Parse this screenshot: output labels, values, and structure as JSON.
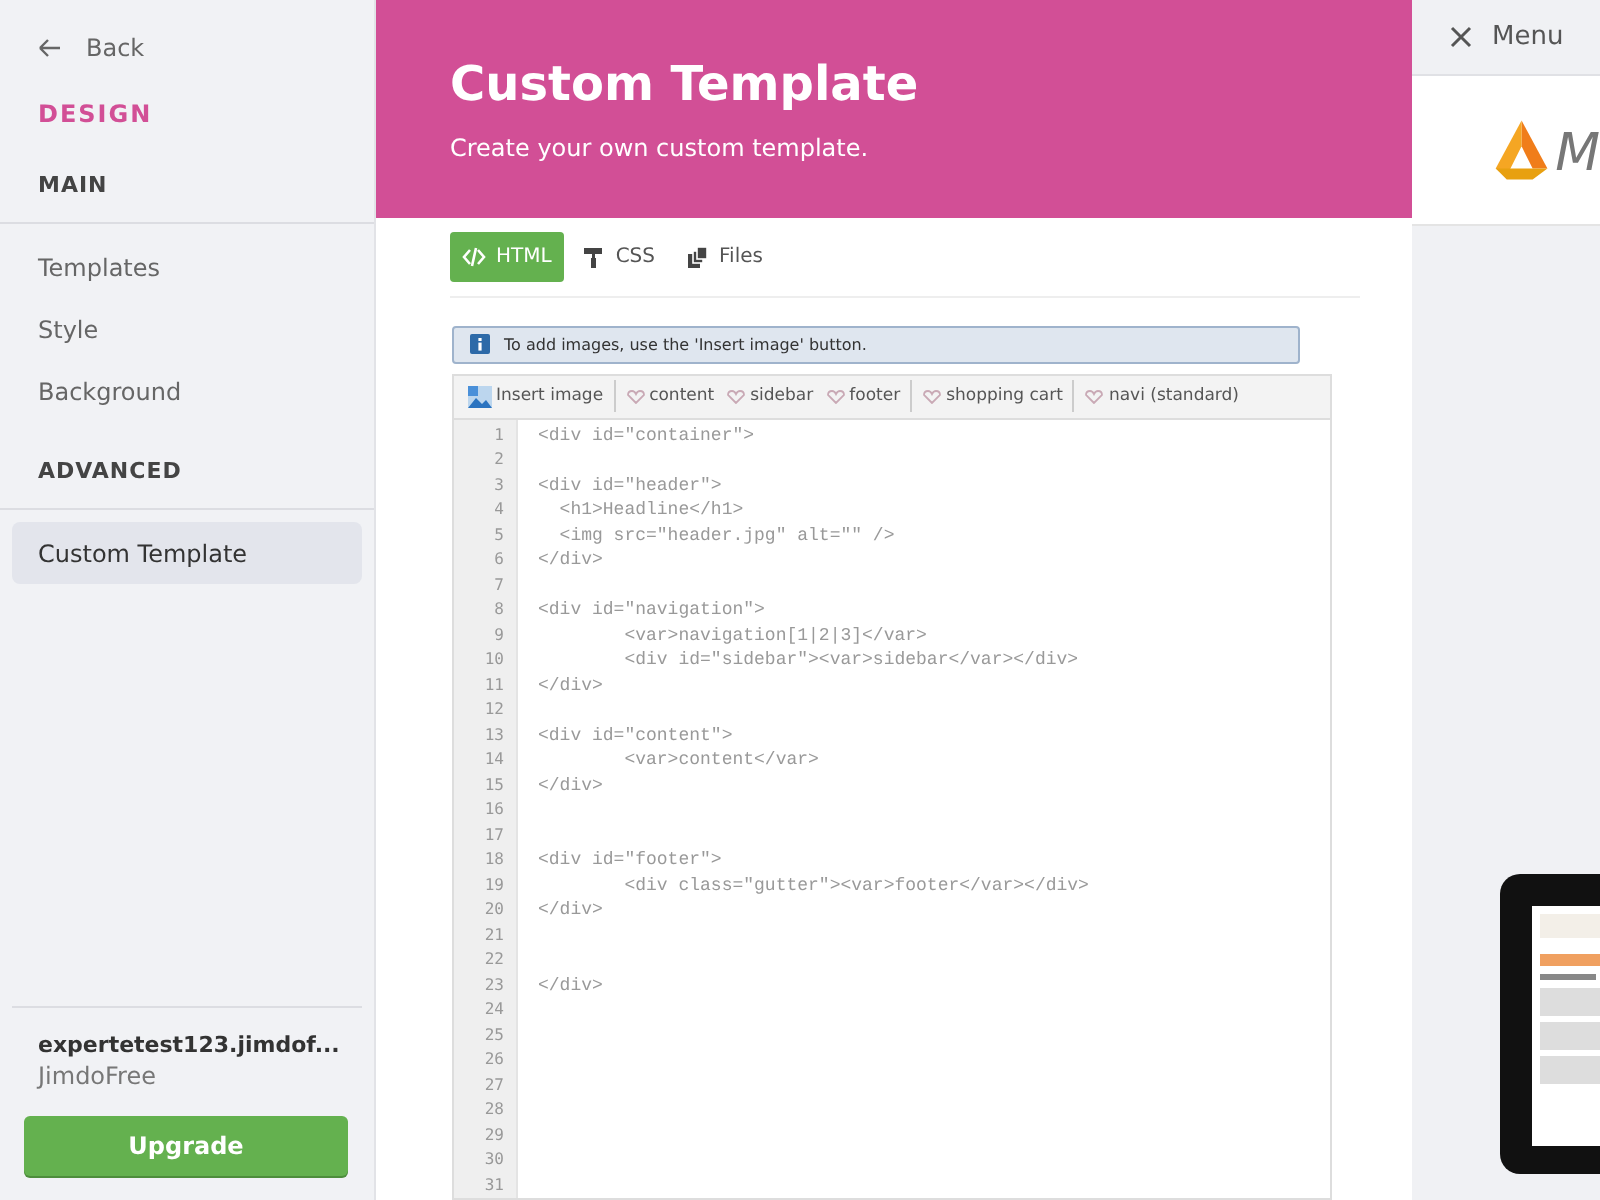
{
  "sidebar": {
    "back": "Back",
    "title": "DESIGN",
    "sections": [
      {
        "heading": "MAIN",
        "items": [
          {
            "label": "Templates",
            "selected": false
          },
          {
            "label": "Style",
            "selected": false
          },
          {
            "label": "Background",
            "selected": false
          }
        ]
      },
      {
        "heading": "ADVANCED",
        "items": [
          {
            "label": "Custom Template",
            "selected": true
          }
        ]
      }
    ],
    "account": {
      "site": "expertetest123.jimdof...",
      "plan": "JimdoFree"
    },
    "upgrade_button": "Upgrade"
  },
  "header": {
    "title": "Custom Template",
    "subtitle": "Create your own custom template."
  },
  "tabs": [
    {
      "kind": "code",
      "label": "HTML",
      "selected": true
    },
    {
      "kind": "brush",
      "label": "CSS",
      "selected": false
    },
    {
      "kind": "files",
      "label": "Files",
      "selected": false
    }
  ],
  "notice": "To add images, use the 'Insert image' button.",
  "toolbar": [
    {
      "kind": "image",
      "label": "Insert image",
      "divider_after": true
    },
    {
      "kind": "variable",
      "label": "content",
      "divider_after": false
    },
    {
      "kind": "variable",
      "label": "sidebar",
      "divider_after": false
    },
    {
      "kind": "variable",
      "label": "footer",
      "divider_after": true
    },
    {
      "kind": "variable",
      "label": "shopping cart",
      "divider_after": true
    },
    {
      "kind": "variable",
      "label": "navi (standard)",
      "divider_after": false
    }
  ],
  "editor": {
    "lines": [
      {
        "number": "1",
        "code": "<div id=\"container\">"
      },
      {
        "number": "2"
      },
      {
        "number": "3",
        "code": "<div id=\"header\">"
      },
      {
        "number": "4",
        "code": "  <h1>Headline</h1>"
      },
      {
        "number": "5",
        "code": "  <img src=\"header.jpg\" alt=\"\" />"
      },
      {
        "number": "6",
        "code": "</div>"
      },
      {
        "number": "7"
      },
      {
        "number": "8",
        "code": "<div id=\"navigation\">"
      },
      {
        "number": "9",
        "code": "        <var>navigation[1|2|3]</var>"
      },
      {
        "number": "10",
        "code": "        <div id=\"sidebar\"><var>sidebar</var></div>"
      },
      {
        "number": "11",
        "code": "</div>"
      },
      {
        "number": "12"
      },
      {
        "number": "13",
        "code": "<div id=\"content\">"
      },
      {
        "number": "14",
        "code": "        <var>content</var>"
      },
      {
        "number": "15",
        "code": "</div>"
      },
      {
        "number": "16"
      },
      {
        "number": "17"
      },
      {
        "number": "18",
        "code": "<div id=\"footer\">"
      },
      {
        "number": "19",
        "code": "        <div class=\"gutter\"><var>footer</var></div>"
      },
      {
        "number": "20",
        "code": "</div>"
      },
      {
        "number": "21"
      },
      {
        "number": "22"
      },
      {
        "number": "23",
        "code": "</div>"
      },
      {
        "number": "24"
      },
      {
        "number": "25"
      },
      {
        "number": "26"
      },
      {
        "number": "27"
      },
      {
        "number": "28"
      },
      {
        "number": "29"
      },
      {
        "number": "30"
      },
      {
        "number": "31"
      }
    ]
  },
  "preview": {
    "menu": "Menu",
    "logo_text": "M"
  }
}
